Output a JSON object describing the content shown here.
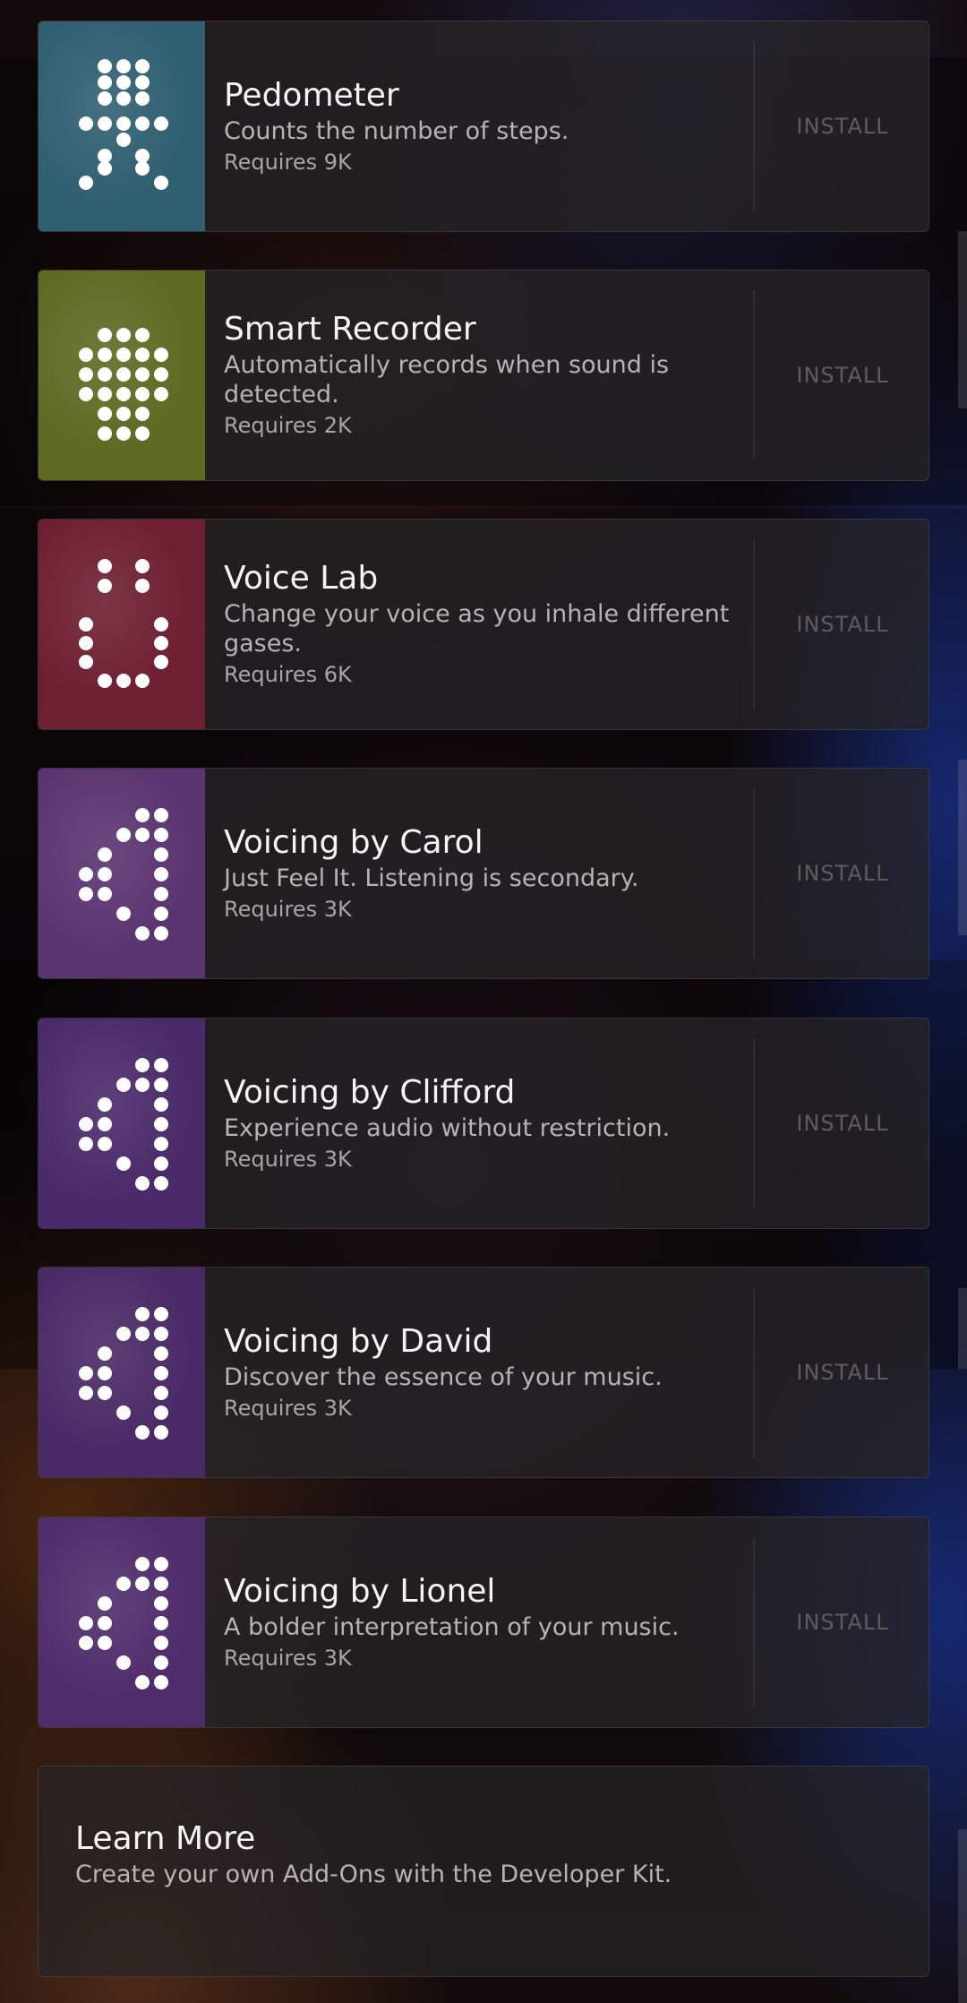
{
  "addons": [
    {
      "name": "Pedometer",
      "description": "Counts the number of steps.",
      "requirement": "Requires 9K",
      "action": "INSTALL",
      "icon": "pedometer-icon",
      "color": "#2f5f70"
    },
    {
      "name": "Smart Recorder",
      "description": "Automatically records when sound is detected.",
      "requirement": "Requires 2K",
      "action": "INSTALL",
      "icon": "microphone-grid-icon",
      "color": "#5e6a22"
    },
    {
      "name": "Voice Lab",
      "description": "Change your voice as you inhale different gases.",
      "requirement": "Requires 6K",
      "action": "INSTALL",
      "icon": "flask-icon",
      "color": "#6e1f31"
    },
    {
      "name": "Voicing by Carol",
      "description": "Just Feel It. Listening is secondary.",
      "requirement": "Requires 3K",
      "action": "INSTALL",
      "icon": "speaker-icon",
      "color": "#5a3470"
    },
    {
      "name": "Voicing by Clifford",
      "description": "Experience audio without restriction.",
      "requirement": "Requires 3K",
      "action": "INSTALL",
      "icon": "speaker-icon",
      "color": "#4a2a6a"
    },
    {
      "name": "Voicing by David",
      "description": "Discover the essence of your music.",
      "requirement": "Requires 3K",
      "action": "INSTALL",
      "icon": "speaker-icon",
      "color": "#4a2a66"
    },
    {
      "name": "Voicing by Lionel",
      "description": "A bolder interpretation of your music.",
      "requirement": "Requires 3K",
      "action": "INSTALL",
      "icon": "speaker-icon",
      "color": "#4f2c6b"
    }
  ],
  "learn_more": {
    "title": "Learn More",
    "description": "Create your own Add-Ons with the Developer Kit."
  }
}
